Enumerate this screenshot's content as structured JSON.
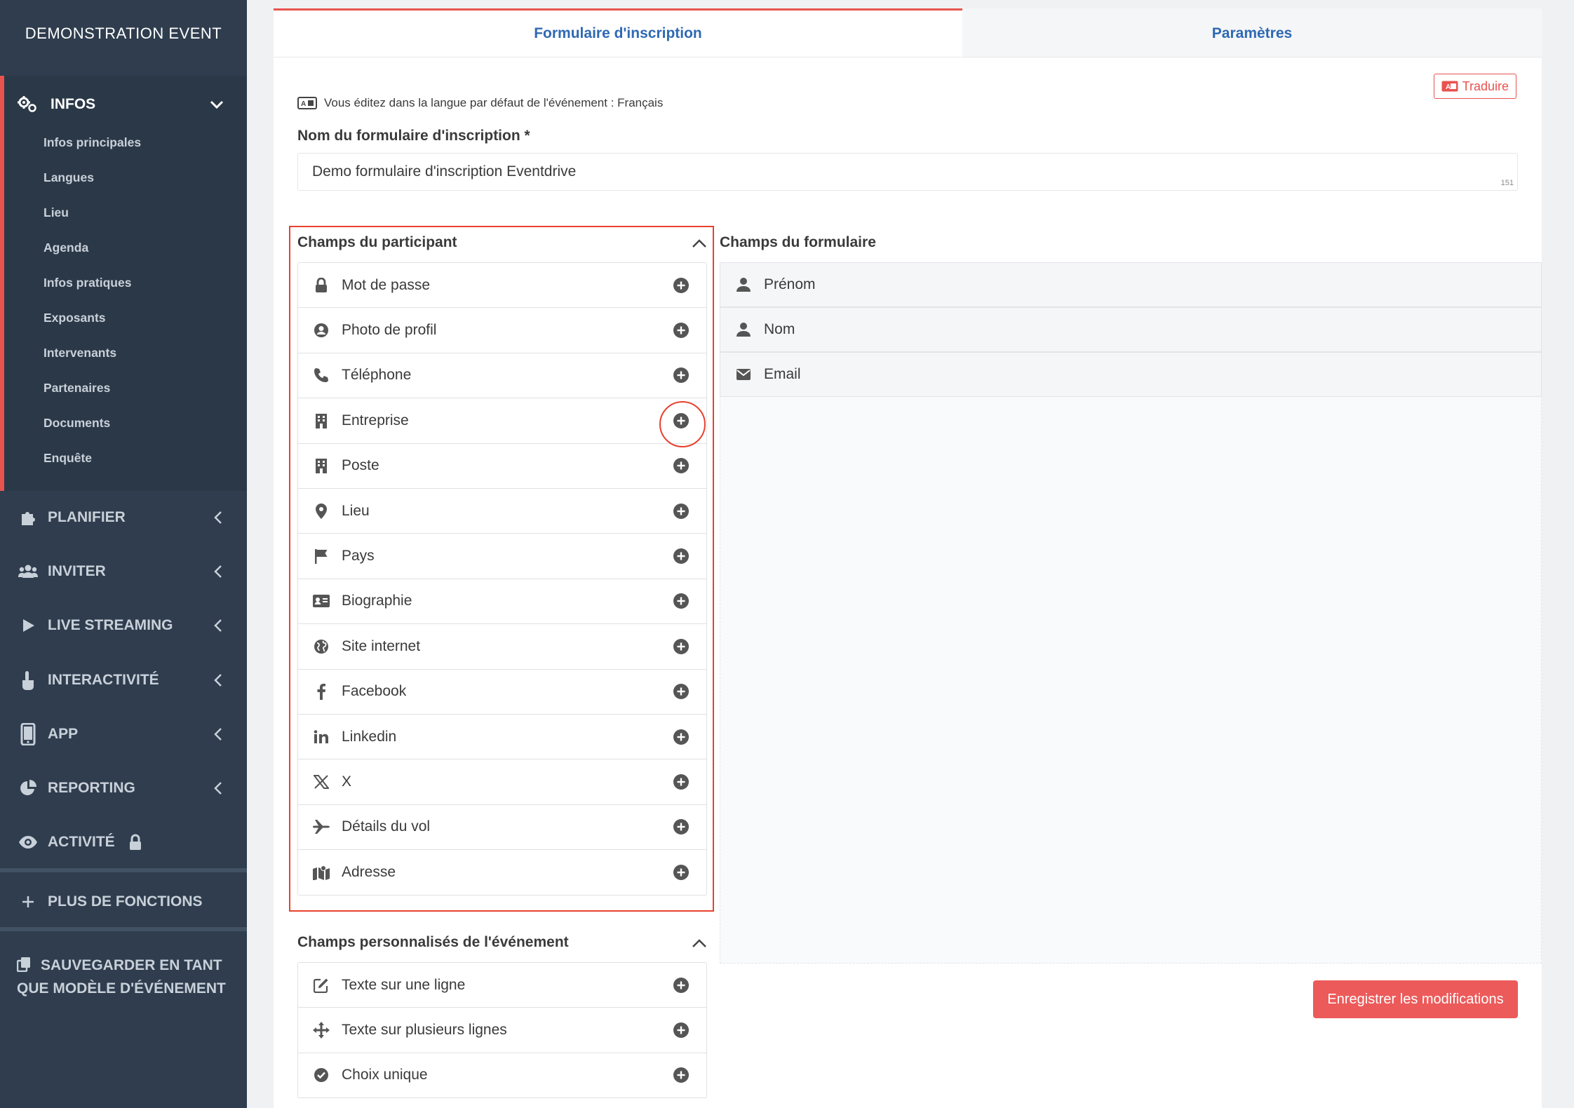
{
  "sidebar": {
    "brand": "DEMONSTRATION EVENT",
    "infos": {
      "label": "INFOS",
      "items": [
        "Infos principales",
        "Langues",
        "Lieu",
        "Agenda",
        "Infos pratiques",
        "Exposants",
        "Intervenants",
        "Partenaires",
        "Documents",
        "Enquête"
      ]
    },
    "sections": [
      {
        "label": "PLANIFIER",
        "icon": "puzzle-icon"
      },
      {
        "label": "INVITER",
        "icon": "users-icon"
      },
      {
        "label": "LIVE STREAMING",
        "icon": "play-icon"
      },
      {
        "label": "INTERACTIVITÉ",
        "icon": "pointer-hand-icon"
      },
      {
        "label": "APP",
        "icon": "mobile-icon"
      },
      {
        "label": "REPORTING",
        "icon": "pie-chart-icon"
      },
      {
        "label": "ACTIVITÉ",
        "icon": "eye-icon"
      }
    ],
    "more": "PLUS DE FONCTIONS",
    "save_line1": "SAUVEGARDER EN TANT",
    "save_line2": "QUE MODÈLE D'ÉVÉNEMENT"
  },
  "tabs": {
    "form": "Formulaire d'inscription",
    "settings": "Paramètres"
  },
  "translate_label": "Traduire",
  "language_note": "Vous éditez dans la langue par défaut de l'événement : Français",
  "form_name": {
    "label": "Nom du formulaire d'inscription *",
    "value": "Demo formulaire d'inscription Eventdrive",
    "char_count": "151"
  },
  "participant_fields": {
    "title": "Champs du participant",
    "items": [
      {
        "label": "Mot de passe",
        "icon": "lock-icon"
      },
      {
        "label": "Photo de profil",
        "icon": "user-circle-icon"
      },
      {
        "label": "Téléphone",
        "icon": "phone-icon"
      },
      {
        "label": "Entreprise",
        "icon": "building-icon"
      },
      {
        "label": "Poste",
        "icon": "building-icon"
      },
      {
        "label": "Lieu",
        "icon": "map-pin-icon"
      },
      {
        "label": "Pays",
        "icon": "flag-icon"
      },
      {
        "label": "Biographie",
        "icon": "id-card-icon"
      },
      {
        "label": "Site internet",
        "icon": "globe-icon"
      },
      {
        "label": "Facebook",
        "icon": "facebook-icon"
      },
      {
        "label": "Linkedin",
        "icon": "linkedin-icon"
      },
      {
        "label": "X",
        "icon": "x-logo-icon"
      },
      {
        "label": "Détails du vol",
        "icon": "plane-icon"
      },
      {
        "label": "Adresse",
        "icon": "map-icon"
      }
    ]
  },
  "custom_fields": {
    "title": "Champs personnalisés de l'événement",
    "items": [
      {
        "label": "Texte sur une ligne",
        "icon": "edit-icon"
      },
      {
        "label": "Texte sur plusieurs lignes",
        "icon": "move-arrows-icon"
      },
      {
        "label": "Choix unique",
        "icon": "check-circle-icon"
      }
    ]
  },
  "form_fields": {
    "title": "Champs du formulaire",
    "items": [
      {
        "label": "Prénom",
        "icon": "user-icon"
      },
      {
        "label": "Nom",
        "icon": "user-icon"
      },
      {
        "label": "Email",
        "icon": "envelope-icon"
      }
    ]
  },
  "save_button": "Enregistrer les modifications",
  "colors": {
    "sidebar_bg": "#2f3d4e",
    "accent_red": "#e8534e",
    "link_blue": "#2f69b3",
    "save_btn": "#ec5a5a",
    "annotation_red": "#e8412e"
  }
}
